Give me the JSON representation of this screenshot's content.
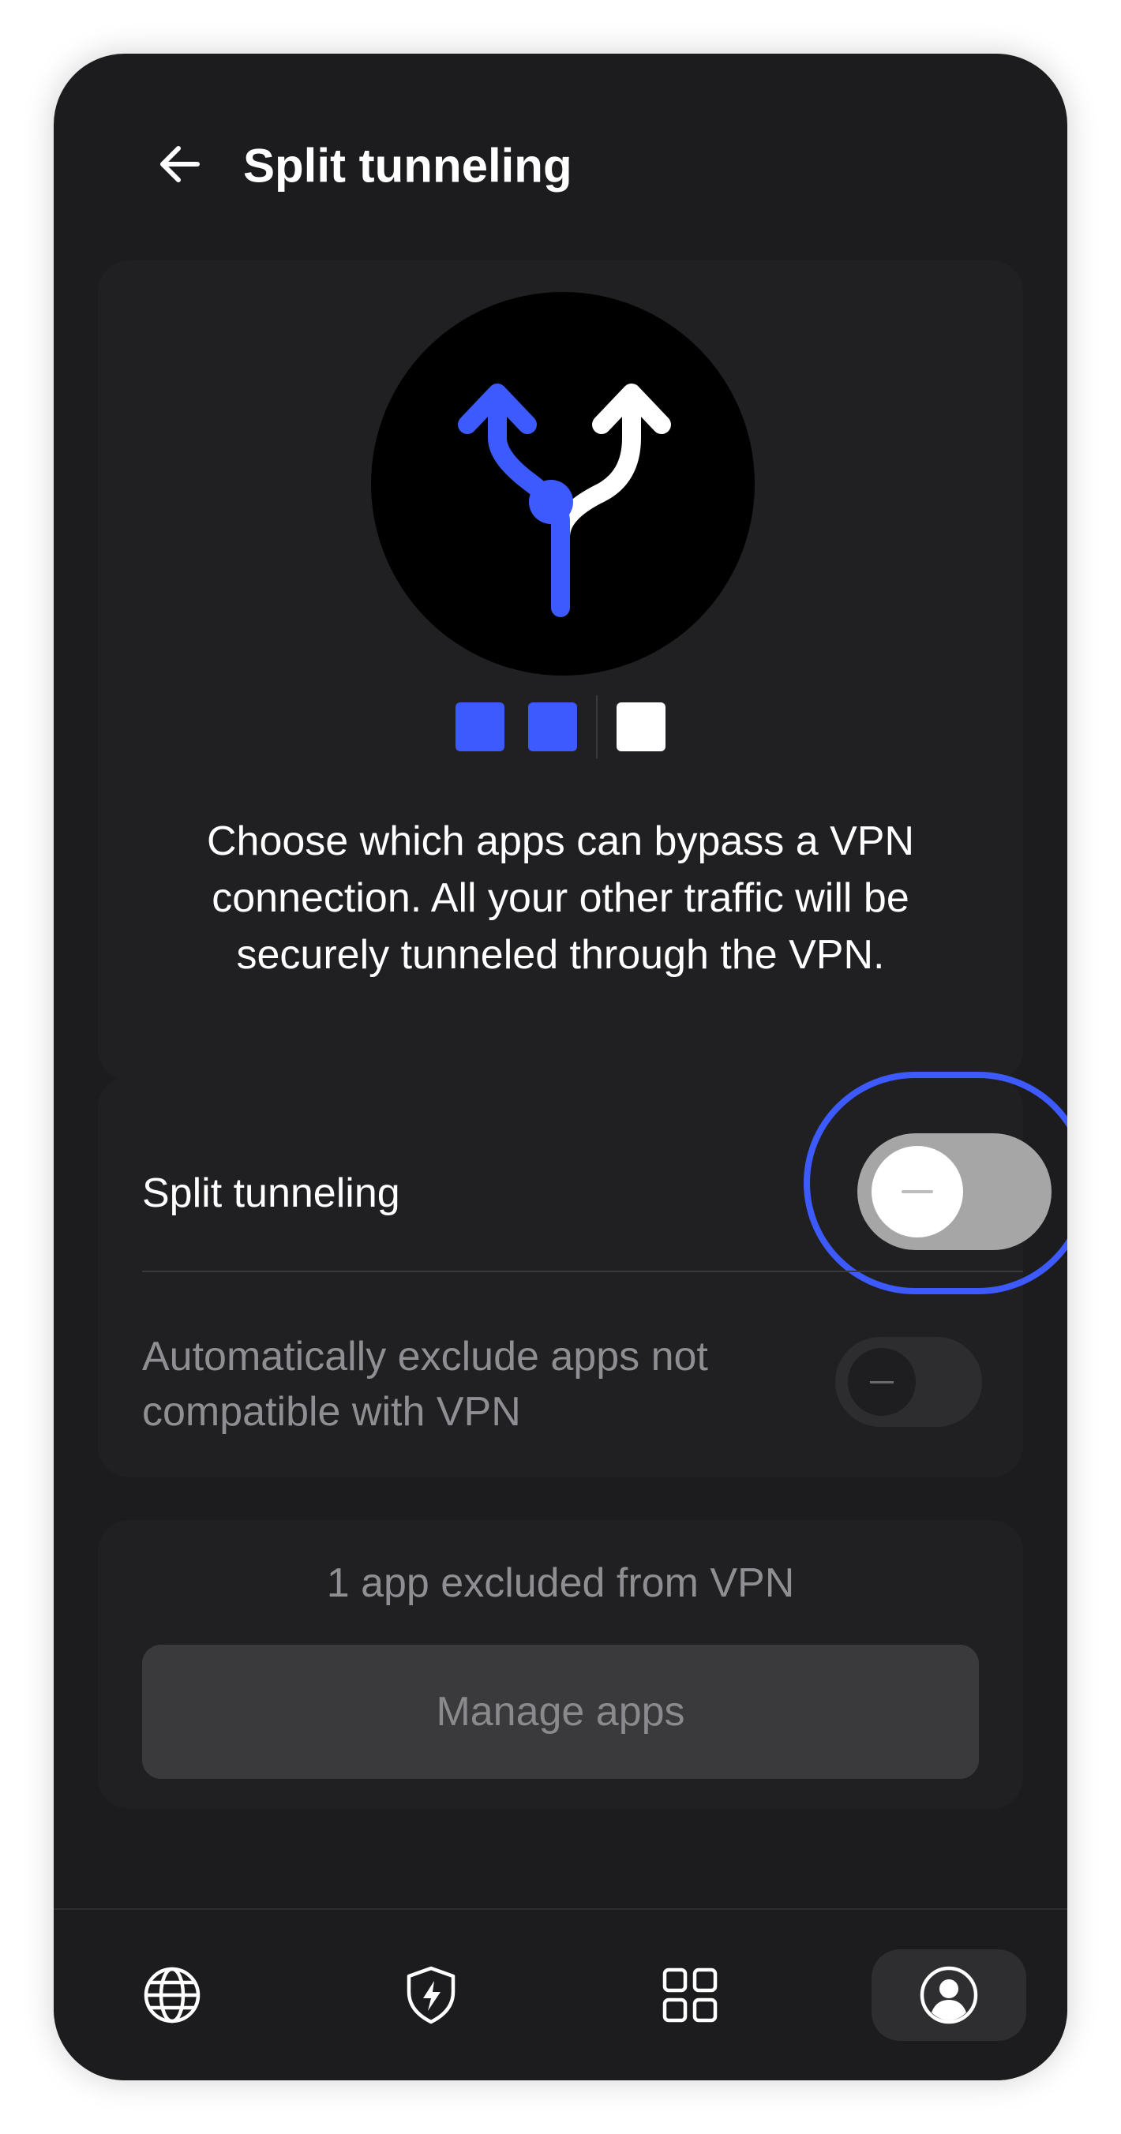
{
  "header": {
    "back_icon": "arrow-left-icon",
    "title": "Split tunneling"
  },
  "hero": {
    "illustration_icon": "split-arrows-icon",
    "description": "Choose which apps can bypass a VPN connection. All your other traffic will be securely tunneled through the VPN.",
    "colors": {
      "accent": "#3d5afe",
      "secondary": "#ffffff",
      "circle": "#000000"
    }
  },
  "settings": {
    "split_tunneling": {
      "label": "Split tunneling",
      "enabled": false
    },
    "auto_exclude": {
      "label": "Automatically exclude apps not compatible with VPN",
      "enabled": false,
      "disabled": true
    }
  },
  "apps": {
    "count_text": "1 app excluded from VPN",
    "manage_label": "Manage apps"
  },
  "nav": {
    "items": [
      {
        "icon": "globe-icon",
        "active": false
      },
      {
        "icon": "shield-bolt-icon",
        "active": false
      },
      {
        "icon": "grid-icon",
        "active": false
      },
      {
        "icon": "profile-icon",
        "active": true
      }
    ]
  },
  "colors": {
    "background": "#1c1c1e",
    "card": "#202022",
    "focus_ring": "#3d5afe"
  }
}
